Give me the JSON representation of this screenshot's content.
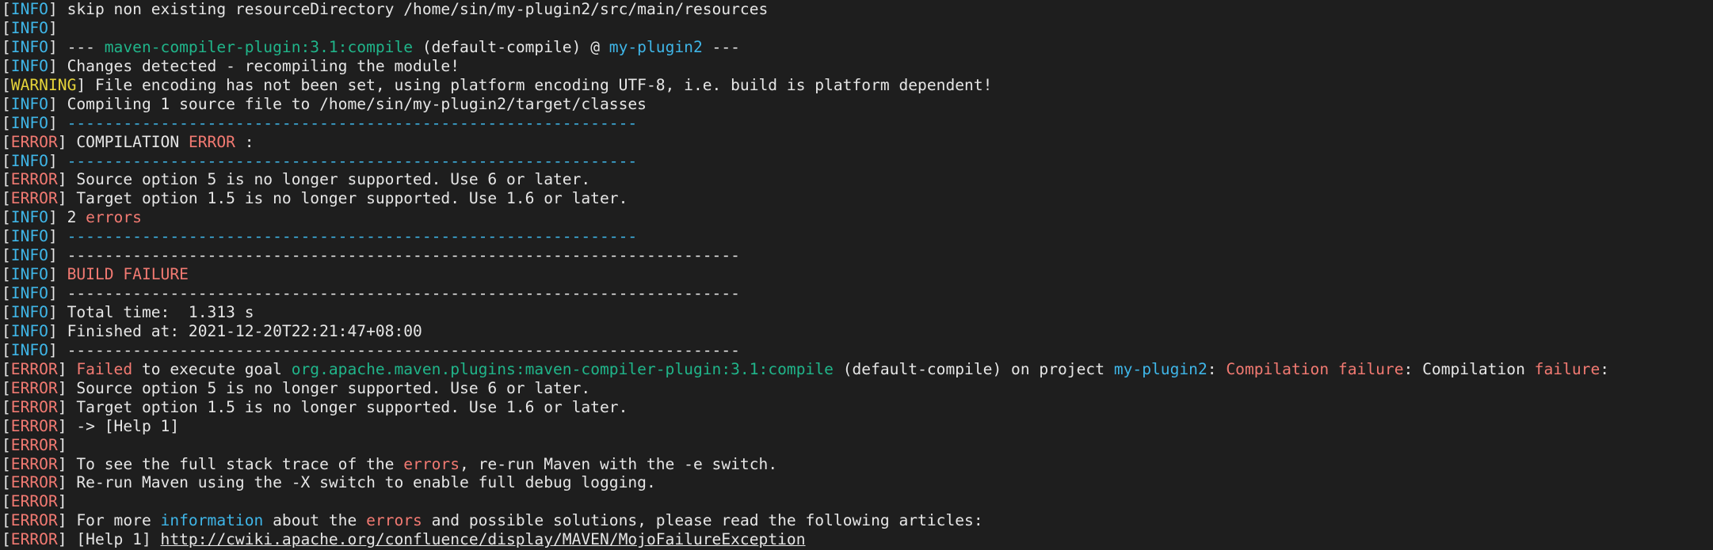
{
  "terminal": {
    "lines": [
      [
        {
          "t": "[",
          "c": "default"
        },
        {
          "t": "INFO",
          "c": "info"
        },
        {
          "t": "] skip non existing resourceDirectory /home/sin/my-plugin2/src/main/resources",
          "c": "default"
        }
      ],
      [
        {
          "t": "[",
          "c": "default"
        },
        {
          "t": "INFO",
          "c": "info"
        },
        {
          "t": "]",
          "c": "default"
        }
      ],
      [
        {
          "t": "[",
          "c": "default"
        },
        {
          "t": "INFO",
          "c": "info"
        },
        {
          "t": "] --- ",
          "c": "default"
        },
        {
          "t": "maven-compiler-plugin:3.1:compile",
          "c": "green"
        },
        {
          "t": " (default-compile) @ ",
          "c": "default"
        },
        {
          "t": "my-plugin2",
          "c": "info"
        },
        {
          "t": " ---",
          "c": "default"
        }
      ],
      [
        {
          "t": "[",
          "c": "default"
        },
        {
          "t": "INFO",
          "c": "info"
        },
        {
          "t": "] Changes detected - recompiling the module!",
          "c": "default"
        }
      ],
      [
        {
          "t": "[",
          "c": "default"
        },
        {
          "t": "WARNING",
          "c": "warning"
        },
        {
          "t": "] File encoding has not been set, using platform encoding UTF-8, i.e. build is platform dependent!",
          "c": "default"
        }
      ],
      [
        {
          "t": "[",
          "c": "default"
        },
        {
          "t": "INFO",
          "c": "info"
        },
        {
          "t": "] Compiling 1 source file to /home/sin/my-plugin2/target/classes",
          "c": "default"
        }
      ],
      [
        {
          "t": "[",
          "c": "default"
        },
        {
          "t": "INFO",
          "c": "info"
        },
        {
          "t": "] ",
          "c": "default"
        },
        {
          "t": "-------------------------------------------------------------",
          "c": "info"
        }
      ],
      [
        {
          "t": "[",
          "c": "default"
        },
        {
          "t": "ERROR",
          "c": "error"
        },
        {
          "t": "] COMPILATION ",
          "c": "default"
        },
        {
          "t": "ERROR",
          "c": "error"
        },
        {
          "t": " :",
          "c": "default"
        }
      ],
      [
        {
          "t": "[",
          "c": "default"
        },
        {
          "t": "INFO",
          "c": "info"
        },
        {
          "t": "] ",
          "c": "default"
        },
        {
          "t": "-------------------------------------------------------------",
          "c": "info"
        }
      ],
      [
        {
          "t": "[",
          "c": "default"
        },
        {
          "t": "ERROR",
          "c": "error"
        },
        {
          "t": "] Source option 5 is no longer supported. Use 6 or later.",
          "c": "default"
        }
      ],
      [
        {
          "t": "[",
          "c": "default"
        },
        {
          "t": "ERROR",
          "c": "error"
        },
        {
          "t": "] Target option 1.5 is no longer supported. Use 1.6 or later.",
          "c": "default"
        }
      ],
      [
        {
          "t": "[",
          "c": "default"
        },
        {
          "t": "INFO",
          "c": "info"
        },
        {
          "t": "] 2 ",
          "c": "default"
        },
        {
          "t": "errors",
          "c": "error"
        }
      ],
      [
        {
          "t": "[",
          "c": "default"
        },
        {
          "t": "INFO",
          "c": "info"
        },
        {
          "t": "] ",
          "c": "default"
        },
        {
          "t": "-------------------------------------------------------------",
          "c": "info"
        }
      ],
      [
        {
          "t": "[",
          "c": "default"
        },
        {
          "t": "INFO",
          "c": "info"
        },
        {
          "t": "] ------------------------------------------------------------------------",
          "c": "default"
        }
      ],
      [
        {
          "t": "[",
          "c": "default"
        },
        {
          "t": "INFO",
          "c": "info"
        },
        {
          "t": "] ",
          "c": "default"
        },
        {
          "t": "BUILD FAILURE",
          "c": "error"
        }
      ],
      [
        {
          "t": "[",
          "c": "default"
        },
        {
          "t": "INFO",
          "c": "info"
        },
        {
          "t": "] ------------------------------------------------------------------------",
          "c": "default"
        }
      ],
      [
        {
          "t": "[",
          "c": "default"
        },
        {
          "t": "INFO",
          "c": "info"
        },
        {
          "t": "] Total time:  1.313 s",
          "c": "default"
        }
      ],
      [
        {
          "t": "[",
          "c": "default"
        },
        {
          "t": "INFO",
          "c": "info"
        },
        {
          "t": "] Finished at: 2021-12-20T22:21:47+08:00",
          "c": "default"
        }
      ],
      [
        {
          "t": "[",
          "c": "default"
        },
        {
          "t": "INFO",
          "c": "info"
        },
        {
          "t": "] ------------------------------------------------------------------------",
          "c": "default"
        }
      ],
      [
        {
          "t": "[",
          "c": "default"
        },
        {
          "t": "ERROR",
          "c": "error"
        },
        {
          "t": "] ",
          "c": "default"
        },
        {
          "t": "Failed",
          "c": "error"
        },
        {
          "t": " to execute goal ",
          "c": "default"
        },
        {
          "t": "org.apache.maven.plugins:maven-compiler-plugin:3.1:compile",
          "c": "green"
        },
        {
          "t": " (default-compile) on project ",
          "c": "default"
        },
        {
          "t": "my-plugin2",
          "c": "info"
        },
        {
          "t": ": ",
          "c": "default"
        },
        {
          "t": "Compilation failure",
          "c": "error"
        },
        {
          "t": ": Compilation ",
          "c": "default"
        },
        {
          "t": "failure",
          "c": "error"
        },
        {
          "t": ":",
          "c": "default"
        }
      ],
      [
        {
          "t": "[",
          "c": "default"
        },
        {
          "t": "ERROR",
          "c": "error"
        },
        {
          "t": "] Source option 5 is no longer supported. Use 6 or later.",
          "c": "default"
        }
      ],
      [
        {
          "t": "[",
          "c": "default"
        },
        {
          "t": "ERROR",
          "c": "error"
        },
        {
          "t": "] Target option 1.5 is no longer supported. Use 1.6 or later.",
          "c": "default"
        }
      ],
      [
        {
          "t": "[",
          "c": "default"
        },
        {
          "t": "ERROR",
          "c": "error"
        },
        {
          "t": "] -> [Help 1]",
          "c": "default"
        }
      ],
      [
        {
          "t": "[",
          "c": "default"
        },
        {
          "t": "ERROR",
          "c": "error"
        },
        {
          "t": "]",
          "c": "default"
        }
      ],
      [
        {
          "t": "[",
          "c": "default"
        },
        {
          "t": "ERROR",
          "c": "error"
        },
        {
          "t": "] To see the full stack trace of the ",
          "c": "default"
        },
        {
          "t": "errors",
          "c": "error"
        },
        {
          "t": ", re-run Maven with the -e switch.",
          "c": "default"
        }
      ],
      [
        {
          "t": "[",
          "c": "default"
        },
        {
          "t": "ERROR",
          "c": "error"
        },
        {
          "t": "] Re-run Maven using the -X switch to enable full debug logging.",
          "c": "default"
        }
      ],
      [
        {
          "t": "[",
          "c": "default"
        },
        {
          "t": "ERROR",
          "c": "error"
        },
        {
          "t": "]",
          "c": "default"
        }
      ],
      [
        {
          "t": "[",
          "c": "default"
        },
        {
          "t": "ERROR",
          "c": "error"
        },
        {
          "t": "] For more ",
          "c": "default"
        },
        {
          "t": "information",
          "c": "info"
        },
        {
          "t": " about the ",
          "c": "default"
        },
        {
          "t": "errors",
          "c": "error"
        },
        {
          "t": " and possible solutions, please read the following articles:",
          "c": "default"
        }
      ],
      [
        {
          "t": "[",
          "c": "default"
        },
        {
          "t": "ERROR",
          "c": "error"
        },
        {
          "t": "] [Help 1] ",
          "c": "default"
        },
        {
          "t": "http://cwiki.apache.org/confluence/display/MAVEN/MojoFailureException",
          "c": "link"
        }
      ]
    ]
  },
  "colors": {
    "background": "#1e1e1e",
    "default": "#e6e6e6",
    "info": "#3fb6e8",
    "warning": "#e6d43a",
    "error": "#f27a72",
    "green": "#20b58a"
  }
}
